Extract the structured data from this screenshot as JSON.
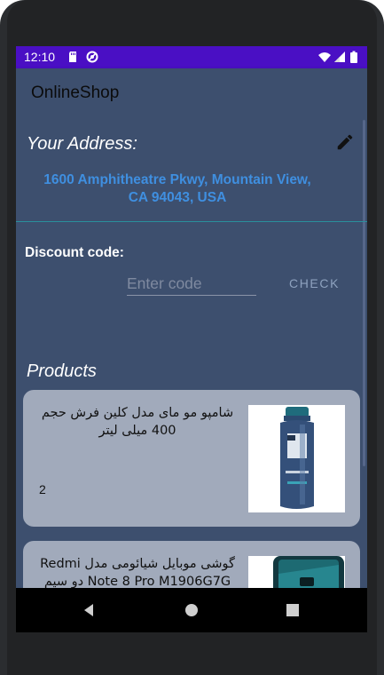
{
  "status_bar": {
    "time": "12:10"
  },
  "app_bar": {
    "title": "OnlineShop"
  },
  "address": {
    "heading": "Your Address:",
    "line1": "1600 Amphitheatre Pkwy, Mountain View,",
    "line2": "CA 94043, USA"
  },
  "discount": {
    "label": "Discount code:",
    "placeholder": "Enter code",
    "value": "",
    "check_label": "CHECK"
  },
  "products": {
    "heading": "Products",
    "items": [
      {
        "name": "شامپو مو مای مدل کلین فرش حجم 400 میلی لیتر",
        "quantity": "2"
      },
      {
        "name": "گوشی موبایل شیائومی مدل Redmi Note 8 Pro M1906G7G دو سیم",
        "quantity": ""
      }
    ]
  },
  "colors": {
    "status_bar": "#4a0fc4",
    "background": "#3d4f6e",
    "address_text": "#3f8fe0",
    "card": "#a1aabb",
    "divider": "#2a8f9c"
  }
}
